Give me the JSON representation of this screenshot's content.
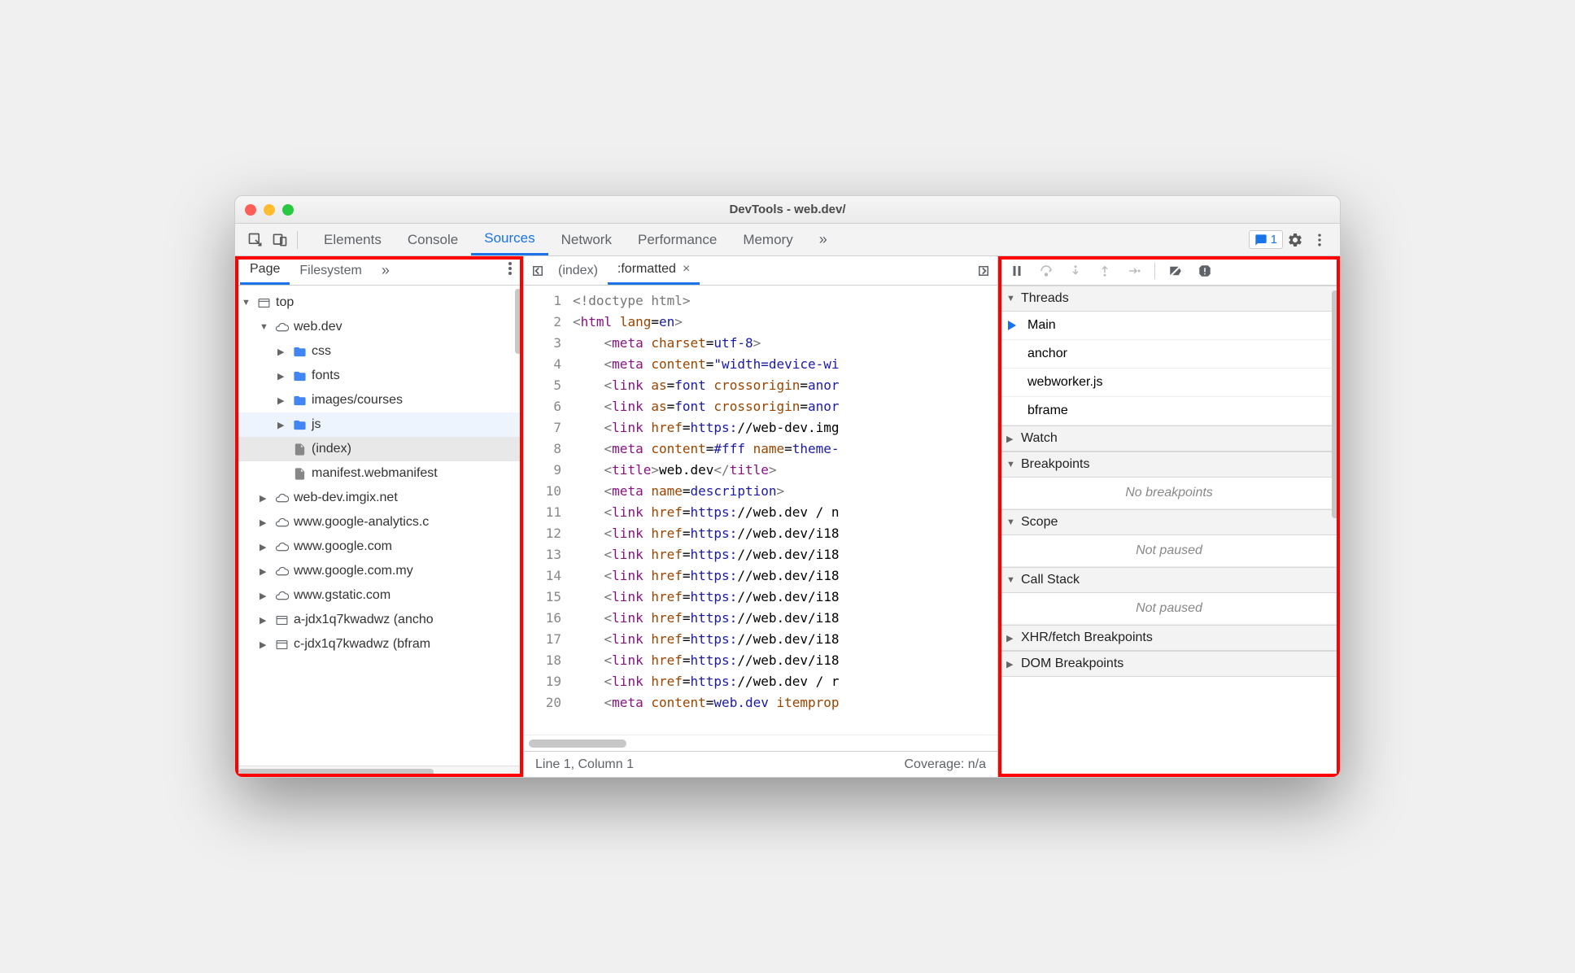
{
  "window": {
    "title": "DevTools - web.dev/"
  },
  "toolbar": {
    "tabs": [
      "Elements",
      "Console",
      "Sources",
      "Network",
      "Performance",
      "Memory"
    ],
    "active_tab": "Sources",
    "overflow": "»",
    "badge_count": "1"
  },
  "navigator": {
    "subtabs": [
      "Page",
      "Filesystem"
    ],
    "active_subtab": "Page",
    "overflow": "»",
    "tree": [
      {
        "depth": 0,
        "expand": "▼",
        "icon": "frame",
        "label": "top"
      },
      {
        "depth": 1,
        "expand": "▼",
        "icon": "cloud",
        "label": "web.dev"
      },
      {
        "depth": 2,
        "expand": "▶",
        "icon": "folder",
        "label": "css"
      },
      {
        "depth": 2,
        "expand": "▶",
        "icon": "folder",
        "label": "fonts"
      },
      {
        "depth": 2,
        "expand": "▶",
        "icon": "folder",
        "label": "images/courses"
      },
      {
        "depth": 2,
        "expand": "▶",
        "icon": "folder",
        "label": "js",
        "hover": true
      },
      {
        "depth": 2,
        "expand": "",
        "icon": "file",
        "label": "(index)",
        "selected": true
      },
      {
        "depth": 2,
        "expand": "",
        "icon": "file",
        "label": "manifest.webmanifest"
      },
      {
        "depth": 1,
        "expand": "▶",
        "icon": "cloud",
        "label": "web-dev.imgix.net"
      },
      {
        "depth": 1,
        "expand": "▶",
        "icon": "cloud",
        "label": "www.google-analytics.c"
      },
      {
        "depth": 1,
        "expand": "▶",
        "icon": "cloud",
        "label": "www.google.com"
      },
      {
        "depth": 1,
        "expand": "▶",
        "icon": "cloud",
        "label": "www.google.com.my"
      },
      {
        "depth": 1,
        "expand": "▶",
        "icon": "cloud",
        "label": "www.gstatic.com"
      },
      {
        "depth": 1,
        "expand": "▶",
        "icon": "frame",
        "label": "a-jdx1q7kwadwz (ancho"
      },
      {
        "depth": 1,
        "expand": "▶",
        "icon": "frame",
        "label": "c-jdx1q7kwadwz (bfram"
      }
    ]
  },
  "editor": {
    "tabs": [
      {
        "label": "(index)",
        "active": false,
        "closable": false
      },
      {
        "label": ":formatted",
        "active": true,
        "closable": true
      }
    ],
    "lines": [
      {
        "n": 1,
        "segs": [
          {
            "c": "t-decl",
            "t": "<!doctype html>"
          }
        ]
      },
      {
        "n": 2,
        "segs": [
          {
            "c": "t-decl",
            "t": "<"
          },
          {
            "c": "t-tag",
            "t": "html"
          },
          {
            "c": "",
            "t": " "
          },
          {
            "c": "t-attr",
            "t": "lang"
          },
          {
            "c": "",
            "t": "="
          },
          {
            "c": "t-val",
            "t": "en"
          },
          {
            "c": "t-decl",
            "t": ">"
          }
        ]
      },
      {
        "n": 3,
        "segs": [
          {
            "c": "",
            "t": "    "
          },
          {
            "c": "t-decl",
            "t": "<"
          },
          {
            "c": "t-tag",
            "t": "meta"
          },
          {
            "c": "",
            "t": " "
          },
          {
            "c": "t-attr",
            "t": "charset"
          },
          {
            "c": "",
            "t": "="
          },
          {
            "c": "t-val",
            "t": "utf-8"
          },
          {
            "c": "t-decl",
            "t": ">"
          }
        ]
      },
      {
        "n": 4,
        "segs": [
          {
            "c": "",
            "t": "    "
          },
          {
            "c": "t-decl",
            "t": "<"
          },
          {
            "c": "t-tag",
            "t": "meta"
          },
          {
            "c": "",
            "t": " "
          },
          {
            "c": "t-attr",
            "t": "content"
          },
          {
            "c": "",
            "t": "="
          },
          {
            "c": "t-val",
            "t": "\"width=device-wi"
          }
        ]
      },
      {
        "n": 5,
        "segs": [
          {
            "c": "",
            "t": "    "
          },
          {
            "c": "t-decl",
            "t": "<"
          },
          {
            "c": "t-tag",
            "t": "link"
          },
          {
            "c": "",
            "t": " "
          },
          {
            "c": "t-attr",
            "t": "as"
          },
          {
            "c": "",
            "t": "="
          },
          {
            "c": "t-val",
            "t": "font"
          },
          {
            "c": "",
            "t": " "
          },
          {
            "c": "t-attr",
            "t": "crossorigin"
          },
          {
            "c": "",
            "t": "="
          },
          {
            "c": "t-val",
            "t": "anor"
          }
        ]
      },
      {
        "n": 6,
        "segs": [
          {
            "c": "",
            "t": "    "
          },
          {
            "c": "t-decl",
            "t": "<"
          },
          {
            "c": "t-tag",
            "t": "link"
          },
          {
            "c": "",
            "t": " "
          },
          {
            "c": "t-attr",
            "t": "as"
          },
          {
            "c": "",
            "t": "="
          },
          {
            "c": "t-val",
            "t": "font"
          },
          {
            "c": "",
            "t": " "
          },
          {
            "c": "t-attr",
            "t": "crossorigin"
          },
          {
            "c": "",
            "t": "="
          },
          {
            "c": "t-val",
            "t": "anor"
          }
        ]
      },
      {
        "n": 7,
        "segs": [
          {
            "c": "",
            "t": "    "
          },
          {
            "c": "t-decl",
            "t": "<"
          },
          {
            "c": "t-tag",
            "t": "link"
          },
          {
            "c": "",
            "t": " "
          },
          {
            "c": "t-attr",
            "t": "href"
          },
          {
            "c": "",
            "t": "="
          },
          {
            "c": "t-val",
            "t": "https:"
          },
          {
            "c": "t-txt",
            "t": "//web-dev.img"
          }
        ]
      },
      {
        "n": 8,
        "segs": [
          {
            "c": "",
            "t": "    "
          },
          {
            "c": "t-decl",
            "t": "<"
          },
          {
            "c": "t-tag",
            "t": "meta"
          },
          {
            "c": "",
            "t": " "
          },
          {
            "c": "t-attr",
            "t": "content"
          },
          {
            "c": "",
            "t": "="
          },
          {
            "c": "t-val",
            "t": "#fff"
          },
          {
            "c": "",
            "t": " "
          },
          {
            "c": "t-attr",
            "t": "name"
          },
          {
            "c": "",
            "t": "="
          },
          {
            "c": "t-val",
            "t": "theme-"
          }
        ]
      },
      {
        "n": 9,
        "segs": [
          {
            "c": "",
            "t": "    "
          },
          {
            "c": "t-decl",
            "t": "<"
          },
          {
            "c": "t-tag",
            "t": "title"
          },
          {
            "c": "t-decl",
            "t": ">"
          },
          {
            "c": "t-txt",
            "t": "web.dev"
          },
          {
            "c": "t-decl",
            "t": "</"
          },
          {
            "c": "t-tag",
            "t": "title"
          },
          {
            "c": "t-decl",
            "t": ">"
          }
        ]
      },
      {
        "n": 10,
        "segs": [
          {
            "c": "",
            "t": "    "
          },
          {
            "c": "t-decl",
            "t": "<"
          },
          {
            "c": "t-tag",
            "t": "meta"
          },
          {
            "c": "",
            "t": " "
          },
          {
            "c": "t-attr",
            "t": "name"
          },
          {
            "c": "",
            "t": "="
          },
          {
            "c": "t-val",
            "t": "description"
          },
          {
            "c": "t-decl",
            "t": ">"
          }
        ]
      },
      {
        "n": 11,
        "segs": [
          {
            "c": "",
            "t": "    "
          },
          {
            "c": "t-decl",
            "t": "<"
          },
          {
            "c": "t-tag",
            "t": "link"
          },
          {
            "c": "",
            "t": " "
          },
          {
            "c": "t-attr",
            "t": "href"
          },
          {
            "c": "",
            "t": "="
          },
          {
            "c": "t-val",
            "t": "https:"
          },
          {
            "c": "t-txt",
            "t": "//web.dev / n"
          }
        ]
      },
      {
        "n": 12,
        "segs": [
          {
            "c": "",
            "t": "    "
          },
          {
            "c": "t-decl",
            "t": "<"
          },
          {
            "c": "t-tag",
            "t": "link"
          },
          {
            "c": "",
            "t": " "
          },
          {
            "c": "t-attr",
            "t": "href"
          },
          {
            "c": "",
            "t": "="
          },
          {
            "c": "t-val",
            "t": "https:"
          },
          {
            "c": "t-txt",
            "t": "//web.dev/i18"
          }
        ]
      },
      {
        "n": 13,
        "segs": [
          {
            "c": "",
            "t": "    "
          },
          {
            "c": "t-decl",
            "t": "<"
          },
          {
            "c": "t-tag",
            "t": "link"
          },
          {
            "c": "",
            "t": " "
          },
          {
            "c": "t-attr",
            "t": "href"
          },
          {
            "c": "",
            "t": "="
          },
          {
            "c": "t-val",
            "t": "https:"
          },
          {
            "c": "t-txt",
            "t": "//web.dev/i18"
          }
        ]
      },
      {
        "n": 14,
        "segs": [
          {
            "c": "",
            "t": "    "
          },
          {
            "c": "t-decl",
            "t": "<"
          },
          {
            "c": "t-tag",
            "t": "link"
          },
          {
            "c": "",
            "t": " "
          },
          {
            "c": "t-attr",
            "t": "href"
          },
          {
            "c": "",
            "t": "="
          },
          {
            "c": "t-val",
            "t": "https:"
          },
          {
            "c": "t-txt",
            "t": "//web.dev/i18"
          }
        ]
      },
      {
        "n": 15,
        "segs": [
          {
            "c": "",
            "t": "    "
          },
          {
            "c": "t-decl",
            "t": "<"
          },
          {
            "c": "t-tag",
            "t": "link"
          },
          {
            "c": "",
            "t": " "
          },
          {
            "c": "t-attr",
            "t": "href"
          },
          {
            "c": "",
            "t": "="
          },
          {
            "c": "t-val",
            "t": "https:"
          },
          {
            "c": "t-txt",
            "t": "//web.dev/i18"
          }
        ]
      },
      {
        "n": 16,
        "segs": [
          {
            "c": "",
            "t": "    "
          },
          {
            "c": "t-decl",
            "t": "<"
          },
          {
            "c": "t-tag",
            "t": "link"
          },
          {
            "c": "",
            "t": " "
          },
          {
            "c": "t-attr",
            "t": "href"
          },
          {
            "c": "",
            "t": "="
          },
          {
            "c": "t-val",
            "t": "https:"
          },
          {
            "c": "t-txt",
            "t": "//web.dev/i18"
          }
        ]
      },
      {
        "n": 17,
        "segs": [
          {
            "c": "",
            "t": "    "
          },
          {
            "c": "t-decl",
            "t": "<"
          },
          {
            "c": "t-tag",
            "t": "link"
          },
          {
            "c": "",
            "t": " "
          },
          {
            "c": "t-attr",
            "t": "href"
          },
          {
            "c": "",
            "t": "="
          },
          {
            "c": "t-val",
            "t": "https:"
          },
          {
            "c": "t-txt",
            "t": "//web.dev/i18"
          }
        ]
      },
      {
        "n": 18,
        "segs": [
          {
            "c": "",
            "t": "    "
          },
          {
            "c": "t-decl",
            "t": "<"
          },
          {
            "c": "t-tag",
            "t": "link"
          },
          {
            "c": "",
            "t": " "
          },
          {
            "c": "t-attr",
            "t": "href"
          },
          {
            "c": "",
            "t": "="
          },
          {
            "c": "t-val",
            "t": "https:"
          },
          {
            "c": "t-txt",
            "t": "//web.dev/i18"
          }
        ]
      },
      {
        "n": 19,
        "segs": [
          {
            "c": "",
            "t": "    "
          },
          {
            "c": "t-decl",
            "t": "<"
          },
          {
            "c": "t-tag",
            "t": "link"
          },
          {
            "c": "",
            "t": " "
          },
          {
            "c": "t-attr",
            "t": "href"
          },
          {
            "c": "",
            "t": "="
          },
          {
            "c": "t-val",
            "t": "https:"
          },
          {
            "c": "t-txt",
            "t": "//web.dev / r"
          }
        ]
      },
      {
        "n": 20,
        "segs": [
          {
            "c": "",
            "t": "    "
          },
          {
            "c": "t-decl",
            "t": "<"
          },
          {
            "c": "t-tag",
            "t": "meta"
          },
          {
            "c": "",
            "t": " "
          },
          {
            "c": "t-attr",
            "t": "content"
          },
          {
            "c": "",
            "t": "="
          },
          {
            "c": "t-val",
            "t": "web.dev"
          },
          {
            "c": "",
            "t": " "
          },
          {
            "c": "t-attr",
            "t": "itemprop"
          }
        ]
      }
    ],
    "status_left": "Line 1, Column 1",
    "status_right": "Coverage: n/a"
  },
  "debugger": {
    "sections": {
      "threads": {
        "title": "Threads",
        "expanded": true,
        "items": [
          {
            "label": "Main",
            "active": true
          },
          {
            "label": "anchor"
          },
          {
            "label": "webworker.js"
          },
          {
            "label": "bframe"
          }
        ]
      },
      "watch": {
        "title": "Watch",
        "expanded": false
      },
      "breakpoints": {
        "title": "Breakpoints",
        "expanded": true,
        "empty": "No breakpoints"
      },
      "scope": {
        "title": "Scope",
        "expanded": true,
        "empty": "Not paused"
      },
      "callstack": {
        "title": "Call Stack",
        "expanded": true,
        "empty": "Not paused"
      },
      "xhr": {
        "title": "XHR/fetch Breakpoints",
        "expanded": false
      },
      "dom": {
        "title": "DOM Breakpoints",
        "expanded": false
      }
    }
  }
}
